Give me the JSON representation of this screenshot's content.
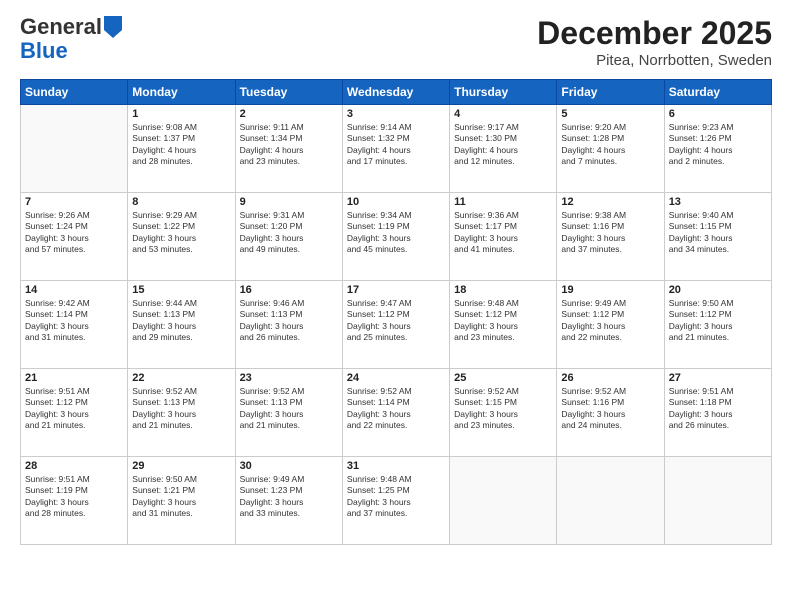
{
  "logo": {
    "general": "General",
    "blue": "Blue"
  },
  "title": "December 2025",
  "location": "Pitea, Norrbotten, Sweden",
  "weekdays": [
    "Sunday",
    "Monday",
    "Tuesday",
    "Wednesday",
    "Thursday",
    "Friday",
    "Saturday"
  ],
  "days": [
    {
      "date": "",
      "info": ""
    },
    {
      "date": "1",
      "info": "Sunrise: 9:08 AM\nSunset: 1:37 PM\nDaylight: 4 hours\nand 28 minutes."
    },
    {
      "date": "2",
      "info": "Sunrise: 9:11 AM\nSunset: 1:34 PM\nDaylight: 4 hours\nand 23 minutes."
    },
    {
      "date": "3",
      "info": "Sunrise: 9:14 AM\nSunset: 1:32 PM\nDaylight: 4 hours\nand 17 minutes."
    },
    {
      "date": "4",
      "info": "Sunrise: 9:17 AM\nSunset: 1:30 PM\nDaylight: 4 hours\nand 12 minutes."
    },
    {
      "date": "5",
      "info": "Sunrise: 9:20 AM\nSunset: 1:28 PM\nDaylight: 4 hours\nand 7 minutes."
    },
    {
      "date": "6",
      "info": "Sunrise: 9:23 AM\nSunset: 1:26 PM\nDaylight: 4 hours\nand 2 minutes."
    },
    {
      "date": "7",
      "info": "Sunrise: 9:26 AM\nSunset: 1:24 PM\nDaylight: 3 hours\nand 57 minutes."
    },
    {
      "date": "8",
      "info": "Sunrise: 9:29 AM\nSunset: 1:22 PM\nDaylight: 3 hours\nand 53 minutes."
    },
    {
      "date": "9",
      "info": "Sunrise: 9:31 AM\nSunset: 1:20 PM\nDaylight: 3 hours\nand 49 minutes."
    },
    {
      "date": "10",
      "info": "Sunrise: 9:34 AM\nSunset: 1:19 PM\nDaylight: 3 hours\nand 45 minutes."
    },
    {
      "date": "11",
      "info": "Sunrise: 9:36 AM\nSunset: 1:17 PM\nDaylight: 3 hours\nand 41 minutes."
    },
    {
      "date": "12",
      "info": "Sunrise: 9:38 AM\nSunset: 1:16 PM\nDaylight: 3 hours\nand 37 minutes."
    },
    {
      "date": "13",
      "info": "Sunrise: 9:40 AM\nSunset: 1:15 PM\nDaylight: 3 hours\nand 34 minutes."
    },
    {
      "date": "14",
      "info": "Sunrise: 9:42 AM\nSunset: 1:14 PM\nDaylight: 3 hours\nand 31 minutes."
    },
    {
      "date": "15",
      "info": "Sunrise: 9:44 AM\nSunset: 1:13 PM\nDaylight: 3 hours\nand 29 minutes."
    },
    {
      "date": "16",
      "info": "Sunrise: 9:46 AM\nSunset: 1:13 PM\nDaylight: 3 hours\nand 26 minutes."
    },
    {
      "date": "17",
      "info": "Sunrise: 9:47 AM\nSunset: 1:12 PM\nDaylight: 3 hours\nand 25 minutes."
    },
    {
      "date": "18",
      "info": "Sunrise: 9:48 AM\nSunset: 1:12 PM\nDaylight: 3 hours\nand 23 minutes."
    },
    {
      "date": "19",
      "info": "Sunrise: 9:49 AM\nSunset: 1:12 PM\nDaylight: 3 hours\nand 22 minutes."
    },
    {
      "date": "20",
      "info": "Sunrise: 9:50 AM\nSunset: 1:12 PM\nDaylight: 3 hours\nand 21 minutes."
    },
    {
      "date": "21",
      "info": "Sunrise: 9:51 AM\nSunset: 1:12 PM\nDaylight: 3 hours\nand 21 minutes."
    },
    {
      "date": "22",
      "info": "Sunrise: 9:52 AM\nSunset: 1:13 PM\nDaylight: 3 hours\nand 21 minutes."
    },
    {
      "date": "23",
      "info": "Sunrise: 9:52 AM\nSunset: 1:13 PM\nDaylight: 3 hours\nand 21 minutes."
    },
    {
      "date": "24",
      "info": "Sunrise: 9:52 AM\nSunset: 1:14 PM\nDaylight: 3 hours\nand 22 minutes."
    },
    {
      "date": "25",
      "info": "Sunrise: 9:52 AM\nSunset: 1:15 PM\nDaylight: 3 hours\nand 23 minutes."
    },
    {
      "date": "26",
      "info": "Sunrise: 9:52 AM\nSunset: 1:16 PM\nDaylight: 3 hours\nand 24 minutes."
    },
    {
      "date": "27",
      "info": "Sunrise: 9:51 AM\nSunset: 1:18 PM\nDaylight: 3 hours\nand 26 minutes."
    },
    {
      "date": "28",
      "info": "Sunrise: 9:51 AM\nSunset: 1:19 PM\nDaylight: 3 hours\nand 28 minutes."
    },
    {
      "date": "29",
      "info": "Sunrise: 9:50 AM\nSunset: 1:21 PM\nDaylight: 3 hours\nand 31 minutes."
    },
    {
      "date": "30",
      "info": "Sunrise: 9:49 AM\nSunset: 1:23 PM\nDaylight: 3 hours\nand 33 minutes."
    },
    {
      "date": "31",
      "info": "Sunrise: 9:48 AM\nSunset: 1:25 PM\nDaylight: 3 hours\nand 37 minutes."
    }
  ]
}
